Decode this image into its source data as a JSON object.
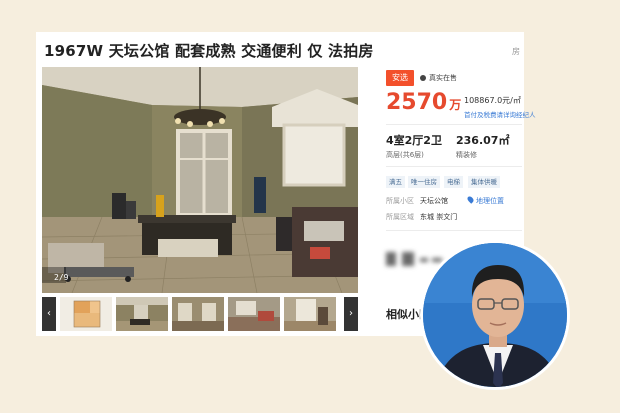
{
  "listing": {
    "title": "1967W 天坛公馆 配套成熟 交通便利 仅 法拍房",
    "title_more": "房",
    "photo_counter": "2/9",
    "prev_icon": "chevron-left-icon",
    "next_icon": "chevron-right-icon"
  },
  "info": {
    "tag_xuan": "安选",
    "tag_true": "真实在售",
    "price": "2570",
    "price_unit": "万",
    "unit_price": "108867.0元/㎡",
    "tax_link": "首付及税费请详询经纪人",
    "layout": "4室2厅2卫",
    "area": "236.07㎡",
    "floor": "高层(共6层)",
    "decoration": "精装修",
    "feature_tags": [
      "满五",
      "唯一住房",
      "电梯",
      "集体供暖"
    ],
    "community_label": "所属小区",
    "community_value": "天坛公馆",
    "map_link": "地理位置",
    "district_label": "所属区域",
    "district_value": "东城  崇文门",
    "similar_title": "相似小区"
  },
  "colors": {
    "accent": "#e64a2e",
    "tag_red": "#f3502b",
    "link_blue": "#3a7bd5",
    "background": "#f6eede"
  }
}
